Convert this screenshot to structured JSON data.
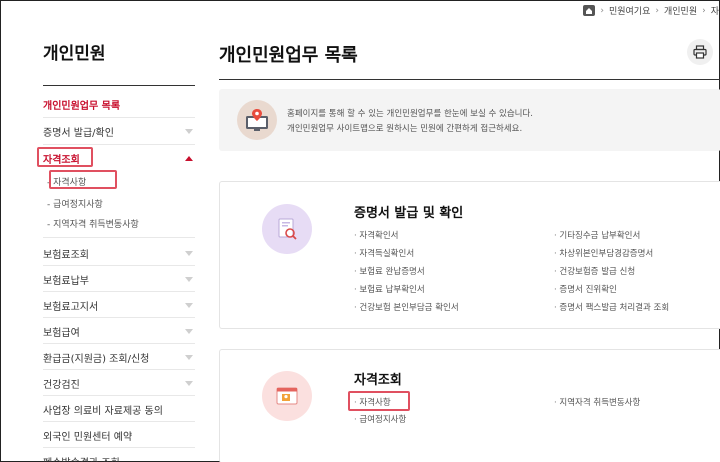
{
  "breadcrumb": {
    "items": [
      "민원여기요",
      "개인민원",
      "자"
    ]
  },
  "sidebar": {
    "title": "개인민원",
    "items": [
      {
        "label": "개인민원업무 목록",
        "active": true
      },
      {
        "label": "증명서 발급/확인"
      },
      {
        "label": "자격조회",
        "expanded": true
      },
      {
        "label": "보험료조회"
      },
      {
        "label": "보험료납부"
      },
      {
        "label": "보험료고지서"
      },
      {
        "label": "보험급여"
      },
      {
        "label": "환급금(지원금) 조회/신청"
      },
      {
        "label": "건강검진"
      },
      {
        "label": "사업장 의료비 자료제공 동의"
      },
      {
        "label": "외국인 민원센터 예약"
      },
      {
        "label": "폐수발송결과 조회"
      }
    ],
    "sub_items": [
      "자격사항",
      "급여정지사항",
      "지역자격 취득변동사항"
    ]
  },
  "main": {
    "title": "개인민원업무 목록",
    "info": {
      "line1": "홈페이지를 통해 할 수 있는 개인민원업무를 한눈에 보실 수 있습니다.",
      "line2": "개인민원업무 사이트맵으로 원하시는 민원에 간편하게 접근하세요."
    },
    "cards": [
      {
        "title": "증명서 발급 및 확인",
        "left_links": [
          "자격확인서",
          "자격득실확인서",
          "보험료 완납증명서",
          "보험료 납부확인서",
          "건강보험 본인부담금 확인서"
        ],
        "right_links": [
          "기타징수금 납부확인서",
          "차상위본인부담경감증명서",
          "건강보험증 발급 신청",
          "증명서 진위확인",
          "증명서 팩스발급 처리결과 조회"
        ]
      },
      {
        "title": "자격조회",
        "left_links": [
          "자격사항",
          "급여정지사항"
        ],
        "right_links": [
          "지역자격 취득변동사항"
        ]
      }
    ]
  },
  "colors": {
    "accent": "#c8102e",
    "highlight_box": "#e05060",
    "cert_icon_bg": "#e7dcf5",
    "qual_icon_bg": "#fbe0df"
  }
}
